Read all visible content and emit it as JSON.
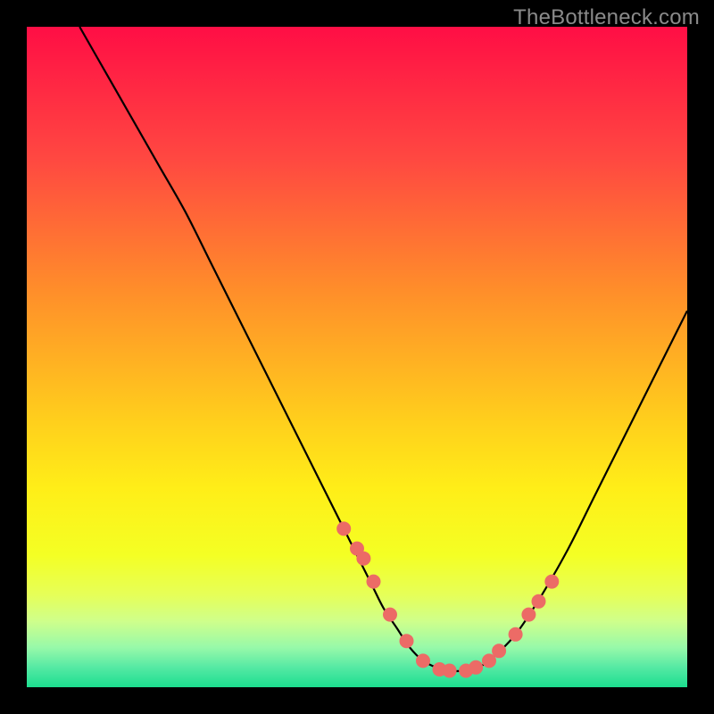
{
  "watermark": "TheBottleneck.com",
  "colors": {
    "background": "#000000",
    "curve_stroke": "#000000",
    "marker_fill": "#EC6B66",
    "marker_stroke": "#EC6B66",
    "gradient_stops": [
      {
        "offset": 0.0,
        "color": "#FF0E45"
      },
      {
        "offset": 0.2,
        "color": "#FF4841"
      },
      {
        "offset": 0.4,
        "color": "#FF8E2A"
      },
      {
        "offset": 0.6,
        "color": "#FFD01C"
      },
      {
        "offset": 0.7,
        "color": "#FFEE18"
      },
      {
        "offset": 0.8,
        "color": "#F4FF24"
      },
      {
        "offset": 0.86,
        "color": "#E6FF58"
      },
      {
        "offset": 0.9,
        "color": "#CFFF8B"
      },
      {
        "offset": 0.94,
        "color": "#97F9A9"
      },
      {
        "offset": 0.97,
        "color": "#55E9A4"
      },
      {
        "offset": 1.0,
        "color": "#1CDE8F"
      }
    ]
  },
  "chart_data": {
    "type": "line",
    "title": "",
    "xlabel": "",
    "ylabel": "",
    "xlim": [
      0,
      100
    ],
    "ylim": [
      0,
      100
    ],
    "series": [
      {
        "name": "curve",
        "x": [
          8,
          12,
          16,
          20,
          24,
          28,
          32,
          36,
          40,
          44,
          48,
          52,
          54,
          56,
          58,
          60,
          62,
          64,
          66,
          68,
          70,
          74,
          78,
          82,
          86,
          90,
          94,
          98,
          100
        ],
        "y": [
          100,
          93,
          86,
          79,
          72,
          64,
          56,
          48,
          40,
          32,
          24,
          16,
          12,
          9,
          6,
          4,
          3,
          2.5,
          2.5,
          3,
          4,
          8,
          14,
          21,
          29,
          37,
          45,
          53,
          57
        ]
      }
    ],
    "markers": {
      "name": "dots",
      "x": [
        48,
        50,
        51,
        52.5,
        55,
        57.5,
        60,
        62.5,
        64,
        66.5,
        68,
        70,
        71.5,
        74,
        76,
        77.5,
        79.5
      ],
      "y": [
        24,
        21,
        19.5,
        16,
        11,
        7,
        4,
        2.7,
        2.5,
        2.5,
        3.0,
        4.0,
        5.5,
        8.0,
        11,
        13,
        16
      ]
    }
  }
}
